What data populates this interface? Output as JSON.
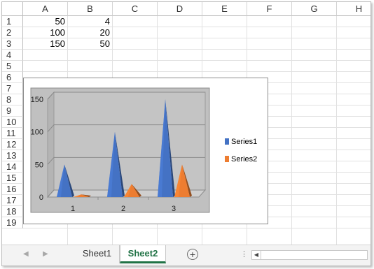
{
  "columns": [
    "A",
    "B",
    "C",
    "D",
    "E",
    "F",
    "G",
    "H"
  ],
  "rows": [
    "1",
    "2",
    "3",
    "4",
    "5",
    "6",
    "7",
    "8",
    "9",
    "10",
    "11",
    "12",
    "13",
    "14",
    "15",
    "16",
    "17",
    "18",
    "19"
  ],
  "cells": [
    [
      "50",
      "4"
    ],
    [
      "100",
      "20"
    ],
    [
      "150",
      "50"
    ]
  ],
  "chart_data": {
    "type": "bar",
    "variant": "3d-pyramid",
    "categories": [
      "1",
      "2",
      "3"
    ],
    "series": [
      {
        "name": "Series1",
        "values": [
          50,
          100,
          150
        ],
        "color": "#4472c4"
      },
      {
        "name": "Series2",
        "values": [
          4,
          20,
          50
        ],
        "color": "#ed7d31"
      }
    ],
    "title": "",
    "xlabel": "",
    "ylabel": "",
    "ylim": [
      0,
      150
    ],
    "yticks": [
      "0",
      "50",
      "100",
      "150"
    ],
    "grid": true,
    "legend": "right",
    "plot_background": "#c0c0c0"
  },
  "sheet_tabs": [
    {
      "label": "Sheet1",
      "active": false
    },
    {
      "label": "Sheet2",
      "active": true
    }
  ],
  "accent_color": "#217346",
  "icons": {
    "add": "plus-circle-icon",
    "more": "ellipsis-icon"
  }
}
